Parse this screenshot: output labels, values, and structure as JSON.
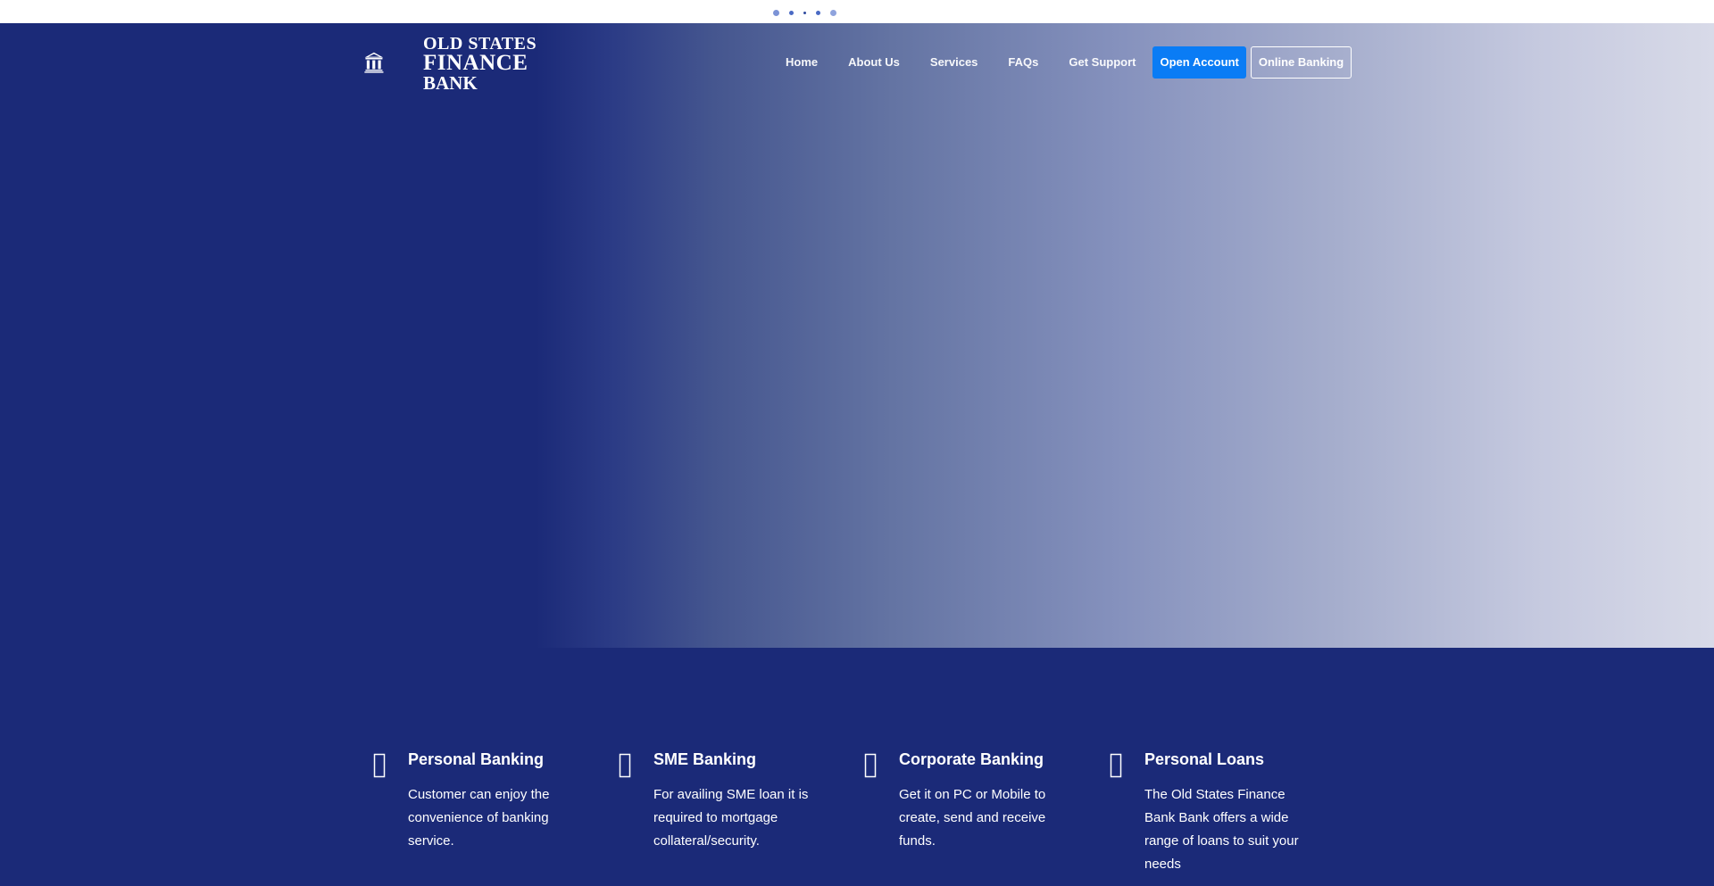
{
  "loader": {
    "dots": [
      "dot",
      "dot",
      "dot",
      "dot",
      "dot"
    ]
  },
  "brand": {
    "line1": "OLD STATES",
    "line2": "FINANCE",
    "line3": "BANK",
    "icon": "bank-columns-icon",
    "color": "#ffffff"
  },
  "nav": {
    "items": [
      {
        "label": "Home"
      },
      {
        "label": "About Us"
      },
      {
        "label": "Services"
      },
      {
        "label": "FAQs"
      },
      {
        "label": "Get Support"
      }
    ],
    "open_account": "Open Account",
    "online_banking": "Online Banking",
    "accent_color": "#0a7cf5"
  },
  "hero": {
    "background": "#1b2a78"
  },
  "features": [
    {
      "icon": "missing-glyph-icon",
      "title": "Personal Banking",
      "description": "Customer can enjoy the convenience of banking service."
    },
    {
      "icon": "missing-glyph-icon",
      "title": "SME Banking",
      "description": "For availing SME loan it is required to mortgage collateral/security."
    },
    {
      "icon": "missing-glyph-icon",
      "title": "Corporate Banking",
      "description": "Get it on PC or Mobile to create, send and receive funds."
    },
    {
      "icon": "missing-glyph-icon",
      "title": "Personal Loans",
      "description": "The Old States Finance Bank Bank offers a wide range of loans to suit your needs"
    }
  ]
}
